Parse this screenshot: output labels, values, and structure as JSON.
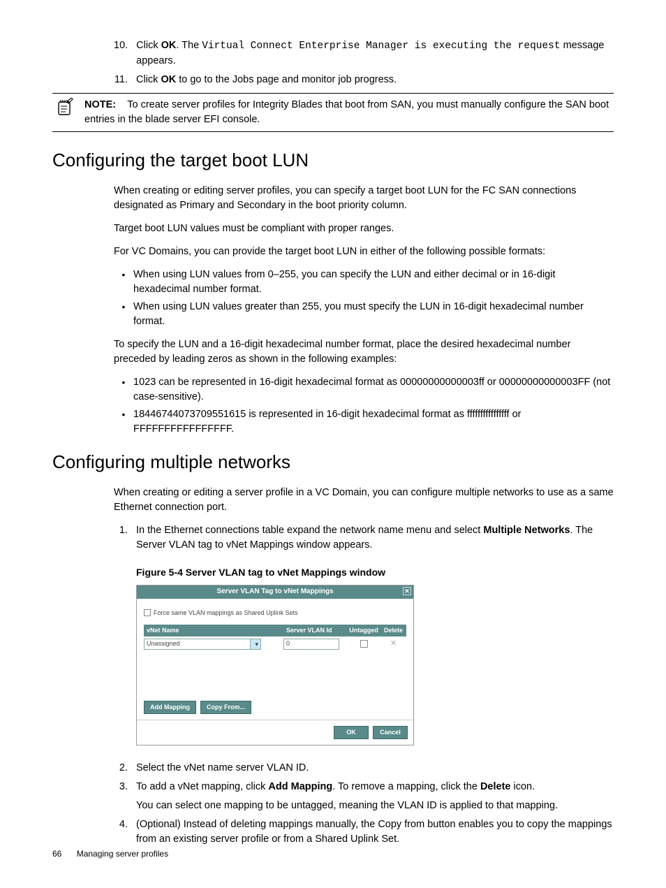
{
  "steps_top": [
    {
      "num": "10.",
      "prefix": "Click ",
      "bold1": "OK",
      "mid": ". The ",
      "mono": "Virtual Connect Enterprise Manager is executing the request",
      "suffix": " message appears."
    },
    {
      "num": "11.",
      "prefix": "Click ",
      "bold1": "OK",
      "suffix": " to go to the Jobs page and monitor job progress."
    }
  ],
  "note": {
    "label": "NOTE:",
    "text": "To create server profiles for Integrity Blades that boot from SAN, you must manually configure the SAN boot entries in the blade server EFI console."
  },
  "section1": {
    "heading": "Configuring the target boot LUN",
    "p1": "When creating or editing server profiles, you can specify a target boot LUN for the FC SAN connections designated as Primary and Secondary in the boot priority column.",
    "p2": "Target boot LUN values must be compliant with proper ranges.",
    "p3": "For VC Domains, you can provide the target boot LUN in either of the following possible formats:",
    "bullets1": [
      "When using LUN values from 0–255, you can specify the LUN and either decimal or in 16-digit hexadecimal number format.",
      "When using LUN values greater than 255, you must specify the LUN in 16-digit hexadecimal number format."
    ],
    "p4": "To specify the LUN and a 16-digit hexadecimal number format, place the desired hexadecimal number preceded by leading zeros as shown in the following examples:",
    "bullets2": [
      "1023 can be represented in 16-digit hexadecimal format as 00000000000003ff or 00000000000003FF (not case-sensitive).",
      "18446744073709551615 is represented in 16-digit hexadecimal format as ffffffffffffffff or FFFFFFFFFFFFFFFF."
    ]
  },
  "section2": {
    "heading": "Configuring multiple networks",
    "p1": "When creating or editing a server profile in a VC Domain, you can configure multiple networks to use as a same Ethernet connection port.",
    "step1": {
      "num": "1.",
      "prefix": "In the Ethernet connections table expand the network name menu and select ",
      "bold": "Multiple Networks",
      "suffix": ". The Server VLAN tag to vNet Mappings window appears."
    },
    "figure_caption": "Figure 5-4 Server VLAN tag to vNet Mappings window",
    "screenshot": {
      "title": "Server VLAN Tag to vNet Mappings",
      "force_chk": "Force same VLAN mappings as Shared Uplink Sets",
      "col1": "vNet Name",
      "col2": "Server VLAN Id",
      "col3": "Untagged",
      "col4": "Delete",
      "row_select": "Unassigned",
      "row_vlan": "0",
      "btn_add": "Add Mapping",
      "btn_copy": "Copy From...",
      "btn_ok": "OK",
      "btn_cancel": "Cancel"
    },
    "step2": {
      "num": "2.",
      "text": "Select the vNet name server VLAN ID."
    },
    "step3": {
      "num": "3.",
      "prefix": "To add a vNet mapping, click ",
      "bold1": "Add Mapping",
      "mid": ". To remove a mapping, click the ",
      "bold2": "Delete",
      "suffix": " icon.",
      "sub": "You can select one mapping to be untagged, meaning the VLAN ID is applied to that mapping."
    },
    "step4": {
      "num": "4.",
      "text": "(Optional) Instead of deleting mappings manually, the Copy from button enables you to copy the mappings from an existing server profile or from a Shared Uplink Set."
    }
  },
  "footer": {
    "page": "66",
    "title": "Managing server profiles"
  }
}
